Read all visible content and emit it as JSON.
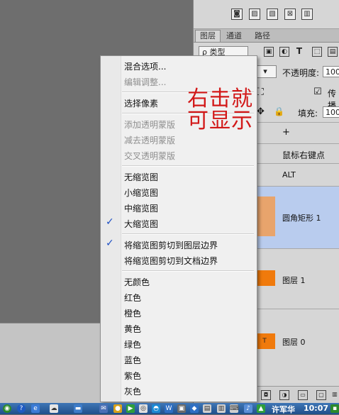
{
  "panel": {
    "tabs": [
      "图层",
      "通道",
      "路径"
    ],
    "filter_kind": "ρ 类型",
    "opacity_label": "不透明度:",
    "opacity_value": "100%",
    "lock_checkbox_label": "传播",
    "fill_label": "填充:",
    "fill_value": "100%",
    "plus_icon": "+",
    "layer_hint_row": "鼠标右键点图...",
    "alt_label": "ALT",
    "layers": [
      {
        "name": "圆角矩形 1",
        "thumb_color": "#e8a46c",
        "selected": true
      },
      {
        "name": "图层 1",
        "thumb_color": "#f07a0c",
        "selected": false
      },
      {
        "name": "图层 0",
        "thumb_color": "#f07a0c",
        "thumb_text": "T",
        "selected": false
      }
    ]
  },
  "context_menu": {
    "items": [
      {
        "label": "混合选项...",
        "disabled": false
      },
      {
        "label": "编辑调整...",
        "disabled": true
      },
      {
        "label": "选择像素",
        "disabled": false
      },
      {
        "label": "添加透明蒙版",
        "disabled": true
      },
      {
        "label": "减去透明蒙版",
        "disabled": true
      },
      {
        "label": "交叉透明蒙版",
        "disabled": true
      },
      {
        "label": "无缩览图",
        "disabled": false
      },
      {
        "label": "小缩览图",
        "disabled": false
      },
      {
        "label": "中缩览图",
        "disabled": false
      },
      {
        "label": "大缩览图",
        "disabled": false,
        "checked": true
      },
      {
        "label": "将缩览图剪切到图层边界",
        "disabled": false,
        "checked": true
      },
      {
        "label": "将缩览图剪切到文档边界",
        "disabled": false
      },
      {
        "label": "无颜色",
        "disabled": false
      },
      {
        "label": "红色",
        "disabled": false
      },
      {
        "label": "橙色",
        "disabled": false
      },
      {
        "label": "黄色",
        "disabled": false
      },
      {
        "label": "绿色",
        "disabled": false
      },
      {
        "label": "蓝色",
        "disabled": false
      },
      {
        "label": "紫色",
        "disabled": false
      },
      {
        "label": "灰色",
        "disabled": false
      }
    ]
  },
  "annotation": {
    "line1": "右击就",
    "line2": "可显示",
    "color": "#d21818"
  },
  "taskbar": {
    "user": "许军华",
    "time": "10:07"
  }
}
